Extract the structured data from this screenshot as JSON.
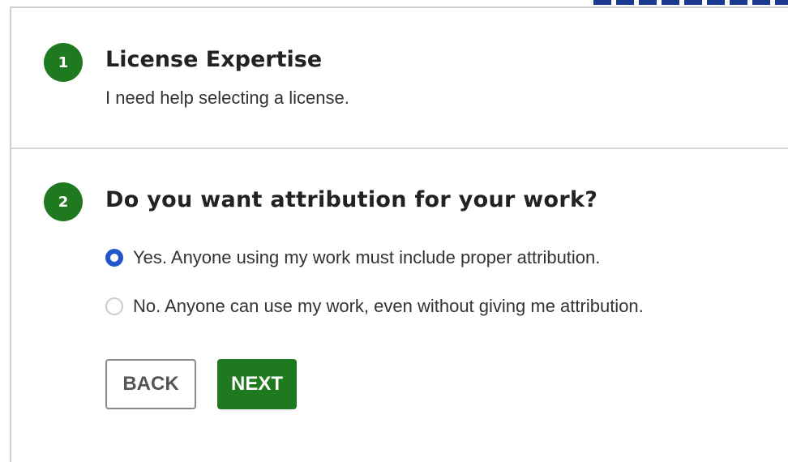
{
  "steps": [
    {
      "number": "1",
      "title": "License Expertise",
      "description": "I need help selecting a license."
    },
    {
      "number": "2",
      "title": "Do you want attribution for your work?",
      "options": [
        {
          "label": "Yes. Anyone using my work must include proper attribution.",
          "selected": true
        },
        {
          "label": "No. Anyone can use my work, even without giving me attribution.",
          "selected": false
        }
      ]
    }
  ],
  "buttons": {
    "back": "BACK",
    "next": "NEXT"
  },
  "colors": {
    "step_badge": "#1f7a1f",
    "radio_selected": "#2255cc",
    "next_button": "#1f7a1f"
  }
}
